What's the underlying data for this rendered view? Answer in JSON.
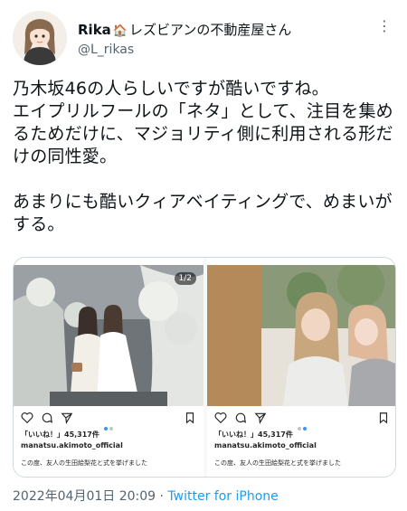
{
  "tweet": {
    "display_name": "Rika",
    "display_name_rest": "レズビアンの不動産屋さん",
    "handle": "@L_rikas",
    "text": "乃木坂46の人らしいですが酷いですね。\nエイプリルフールの「ネタ」として、注目を集めるためだけに、マジョリティ側に利用される形だけの同性愛。\n\nあまりにも酷いクィアベイティングで、めまいがする。",
    "timestamp": "2022年04月01日 20:09",
    "separator": "·",
    "source": "Twitter for iPhone"
  },
  "media": {
    "posts": [
      {
        "counter": "1/2",
        "likes": "「いいね！」45,317件",
        "account": "manatsu.akimoto_official",
        "caption": "この度、友人の生田絵梨花と式を挙げました"
      },
      {
        "counter": "",
        "likes": "「いいね！」45,317件",
        "account": "manatsu.akimoto_official",
        "caption": "この度、友人の生田絵梨花と式を挙げました"
      }
    ]
  },
  "icons": {
    "house": "house-icon",
    "more": "more-icon",
    "heart": "heart-icon",
    "comment": "comment-icon",
    "share": "share-icon",
    "bookmark": "bookmark-icon"
  },
  "colors": {
    "link": "#1d9bf0",
    "secondary_text": "#536471",
    "ig_dot_active": "#3897f0"
  }
}
